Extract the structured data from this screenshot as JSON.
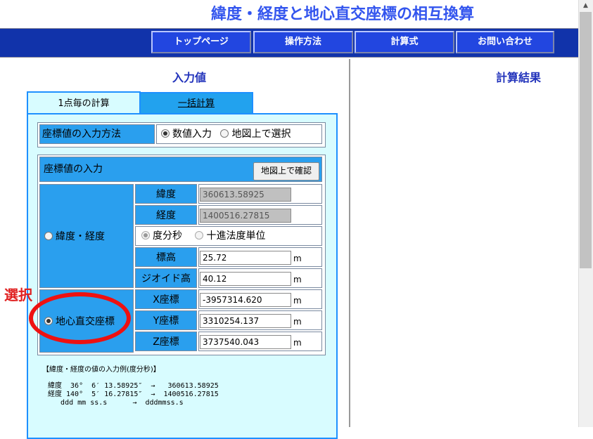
{
  "page": {
    "title": "緯度・経度と地心直交座標の相互換算"
  },
  "nav": [
    "トップページ",
    "操作方法",
    "計算式",
    "お問い合わせ"
  ],
  "left": {
    "heading": "入力値"
  },
  "right": {
    "heading": "計算結果"
  },
  "tabs": {
    "single": "1点毎の計算",
    "batch": "一括計算"
  },
  "input_method": {
    "label": "座標値の入力方法",
    "options": [
      {
        "label": "数値入力",
        "selected": true
      },
      {
        "label": "地図上で選択",
        "selected": false
      }
    ]
  },
  "coord_input": {
    "title": "座標値の入力",
    "map_confirm": "地図上で確認",
    "latlon_radio": "緯度・経度",
    "xyz_radio": "地心直交座標",
    "lat": {
      "label": "緯度",
      "value": "360613.58925"
    },
    "lon": {
      "label": "経度",
      "value": "1400516.27815"
    },
    "format": {
      "dms": "度分秒",
      "decimal": "十進法度単位"
    },
    "height": {
      "label": "標高",
      "value": "25.72",
      "unit": "m"
    },
    "geoid": {
      "label": "ジオイド高",
      "value": "40.12",
      "unit": "m"
    },
    "x": {
      "label": "X座標",
      "value": "-3957314.620",
      "unit": "m"
    },
    "y": {
      "label": "Y座標",
      "value": "3310254.137",
      "unit": "m"
    },
    "z": {
      "label": "Z座標",
      "value": "3737540.043",
      "unit": "m"
    }
  },
  "example": {
    "title": "【緯度・経度の値の入力例(度分秒)】",
    "lines": [
      "緯度  36°  6′ 13.58925″  →   360613.58925",
      "経度 140°  5′ 16.27815″  →  1400516.27815",
      "   ddd mm ss.s      →  dddmmss.s"
    ]
  },
  "annotation": {
    "text": "選択"
  },
  "colors": {
    "accent": "#1133aa",
    "panel": "#d8fcff",
    "cell_blue": "#2a9fee",
    "annotation": "#e11111"
  }
}
